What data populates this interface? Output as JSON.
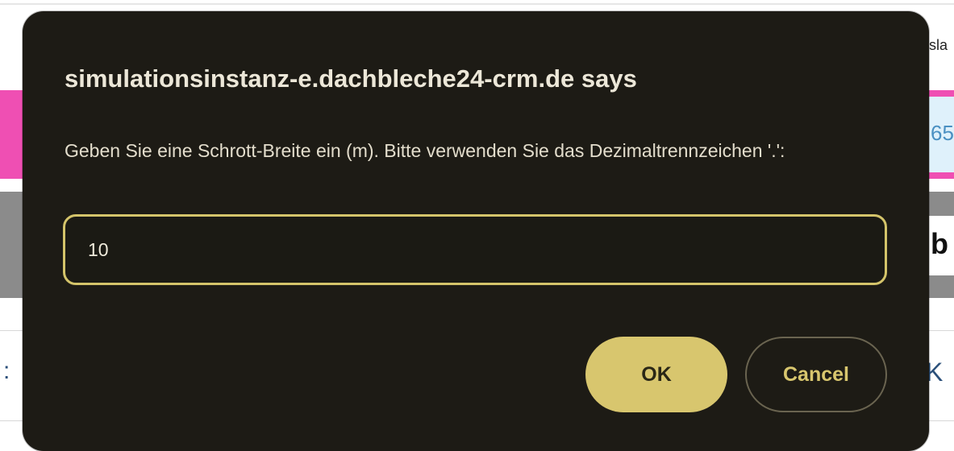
{
  "background_page": {
    "right_edge_snippets": {
      "top_text": "sla",
      "pink_area_text": "65",
      "gray_area_text": "b",
      "bottom_text": "K"
    },
    "left_edge_snippet": ":"
  },
  "dialog": {
    "title": "simulationsinstanz-e.dachbleche24-crm.de says",
    "message": "Geben Sie eine Schrott-Breite ein (m). Bitte verwenden Sie das Dezimaltrennzeichen '.':",
    "input_value": "10",
    "ok_label": "OK",
    "cancel_label": "Cancel"
  },
  "colors": {
    "dialog_bg": "#1d1b15",
    "accent": "#d8c66e",
    "pink": "#ef4fb3"
  }
}
